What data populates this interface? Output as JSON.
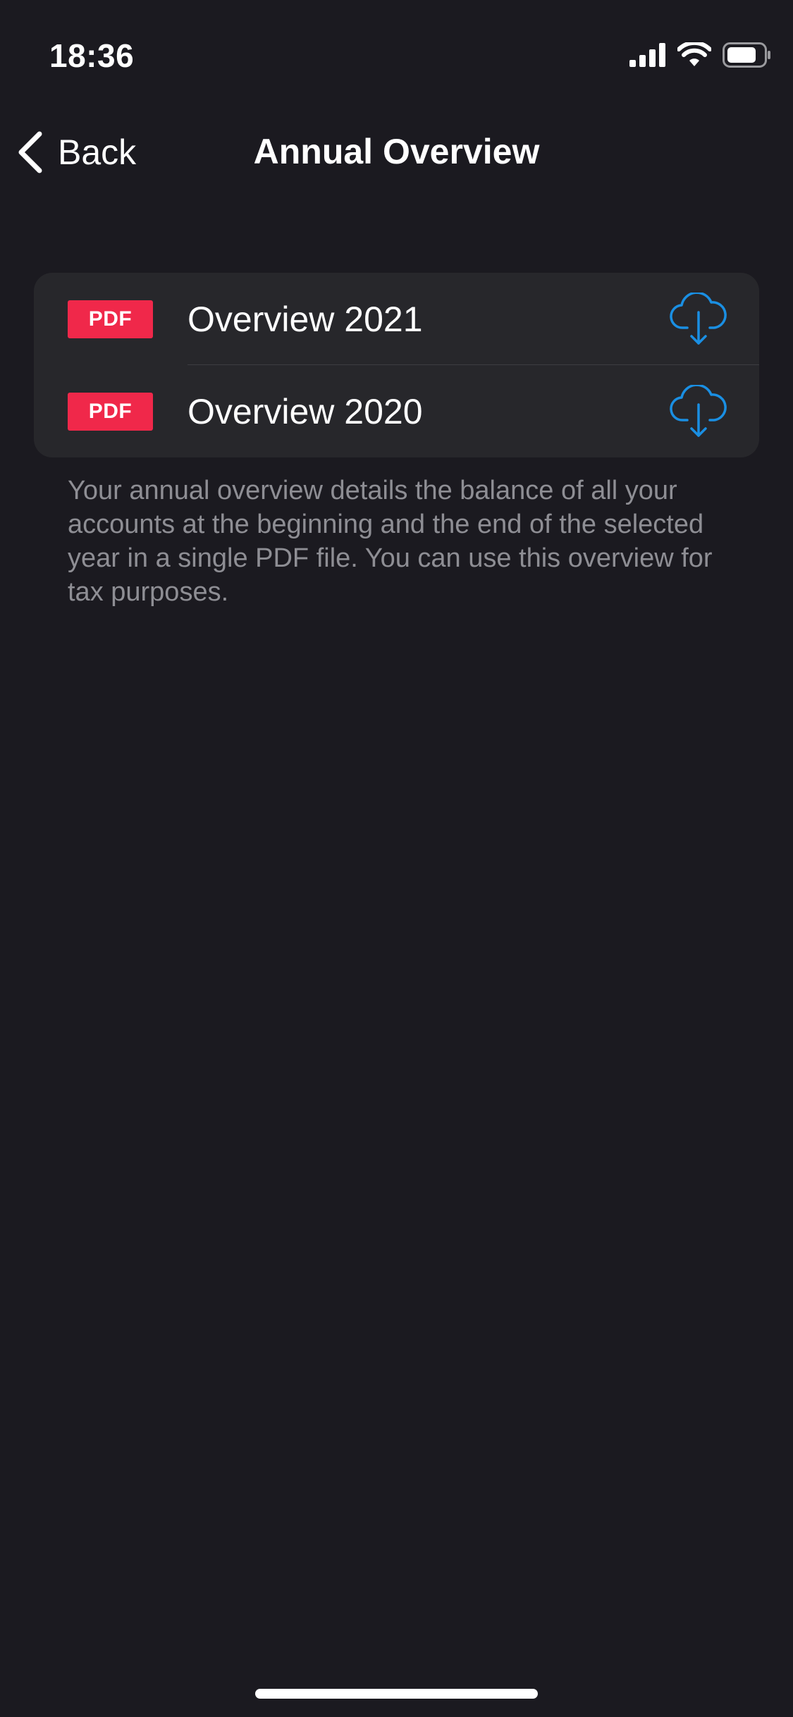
{
  "status_bar": {
    "time": "18:36",
    "icons": [
      "cellular-signal-icon",
      "wifi-icon",
      "battery-icon"
    ]
  },
  "nav": {
    "back_label": "Back",
    "title": "Annual Overview"
  },
  "documents": [
    {
      "badge": "PDF",
      "title": "Overview 2021",
      "action_icon": "cloud-download-icon"
    },
    {
      "badge": "PDF",
      "title": "Overview 2020",
      "action_icon": "cloud-download-icon"
    }
  ],
  "description": "Your annual overview details the balance of all your accounts at the beginning and the end of the selected year in a single PDF file. You can use this overview for tax purposes.",
  "colors": {
    "background": "#1b1a20",
    "card": "#27272b",
    "pdf_badge": "#f0284a",
    "accent": "#1a8fe3",
    "secondary_text": "#8e8e94"
  }
}
